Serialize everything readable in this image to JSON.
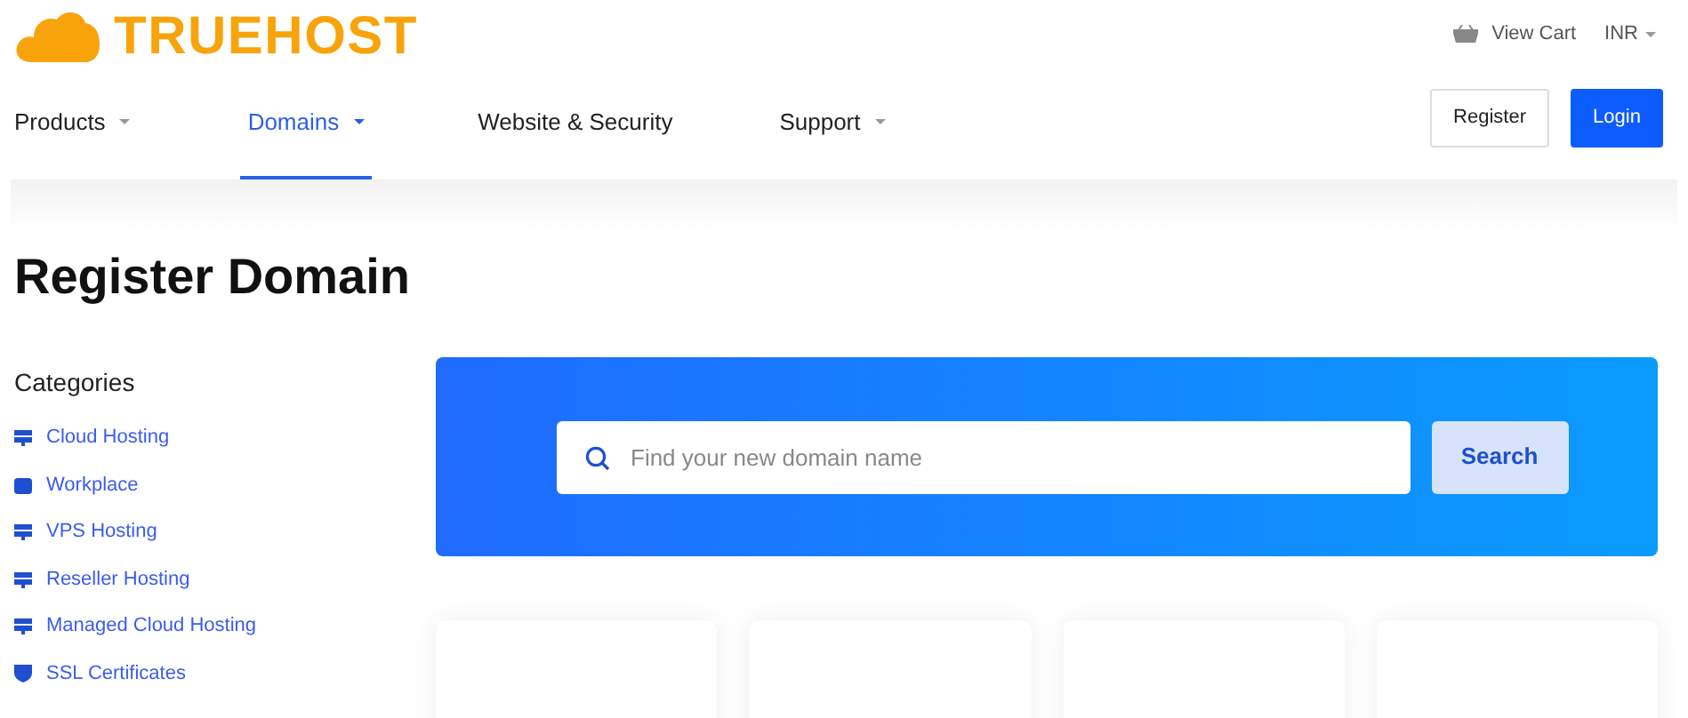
{
  "logo": {
    "text": "TRUEHOST"
  },
  "top_links": {
    "cart": "View Cart",
    "currency": "INR"
  },
  "nav": [
    {
      "label": "Products",
      "caret": true,
      "selected": false
    },
    {
      "label": "Domains",
      "caret": true,
      "selected": true
    },
    {
      "label": "Website & Security",
      "caret": false,
      "selected": false
    },
    {
      "label": "Support",
      "caret": true,
      "selected": false
    }
  ],
  "buttons": [
    {
      "label": "Register",
      "kind": "outline"
    },
    {
      "label": "Login",
      "kind": "primary"
    }
  ],
  "heading": "Register Domain",
  "sidebar": {
    "title": "Categories",
    "items": [
      {
        "label": "Cloud Hosting",
        "kind": "server"
      },
      {
        "label": "Workplace",
        "kind": "briefcase"
      },
      {
        "label": "VPS Hosting",
        "kind": "server"
      },
      {
        "label": "Reseller Hosting",
        "kind": "server"
      },
      {
        "label": "Managed Cloud Hosting",
        "kind": "server"
      },
      {
        "label": "SSL Certificates",
        "kind": "shield"
      }
    ]
  },
  "search": {
    "placeholder": "Find your new domain name",
    "button": "Search"
  },
  "cards": [
    {
      "kind": "card"
    },
    {
      "kind": "card"
    },
    {
      "kind": "card"
    },
    {
      "kind": "card"
    }
  ]
}
